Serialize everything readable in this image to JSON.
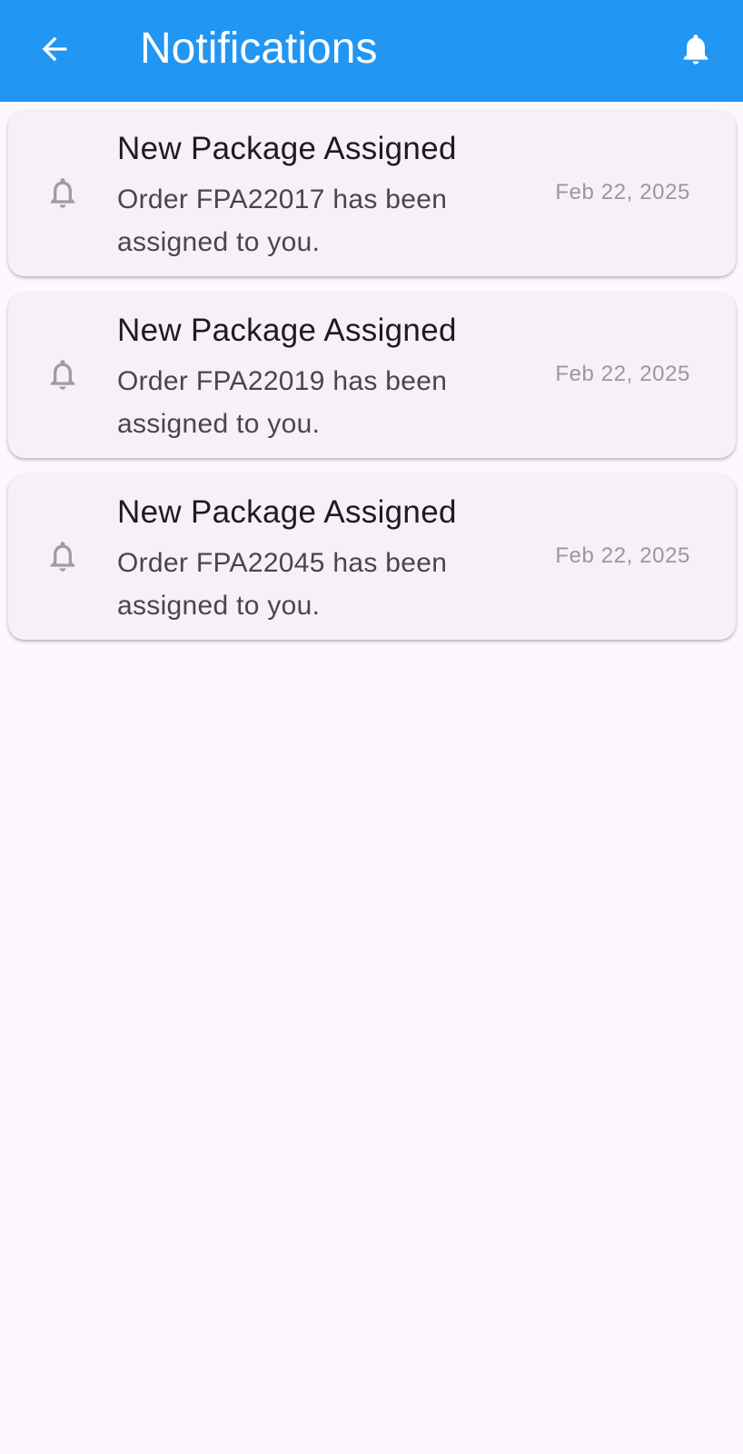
{
  "app_bar": {
    "title": "Notifications",
    "background": "#2196F3",
    "back_icon": "arrow-left-icon",
    "bell_icon": "bell-icon"
  },
  "notifications": [
    {
      "title": "New Package Assigned",
      "message": "Order FPA22017 has been assigned to you.",
      "date": "Feb 22, 2025",
      "icon": "bell-outline-icon"
    },
    {
      "title": "New Package Assigned",
      "message": "Order FPA22019 has been assigned to you.",
      "date": "Feb 22, 2025",
      "icon": "bell-outline-icon"
    },
    {
      "title": "New Package Assigned",
      "message": "Order FPA22045 has been assigned to you.",
      "date": "Feb 22, 2025",
      "icon": "bell-outline-icon"
    }
  ]
}
